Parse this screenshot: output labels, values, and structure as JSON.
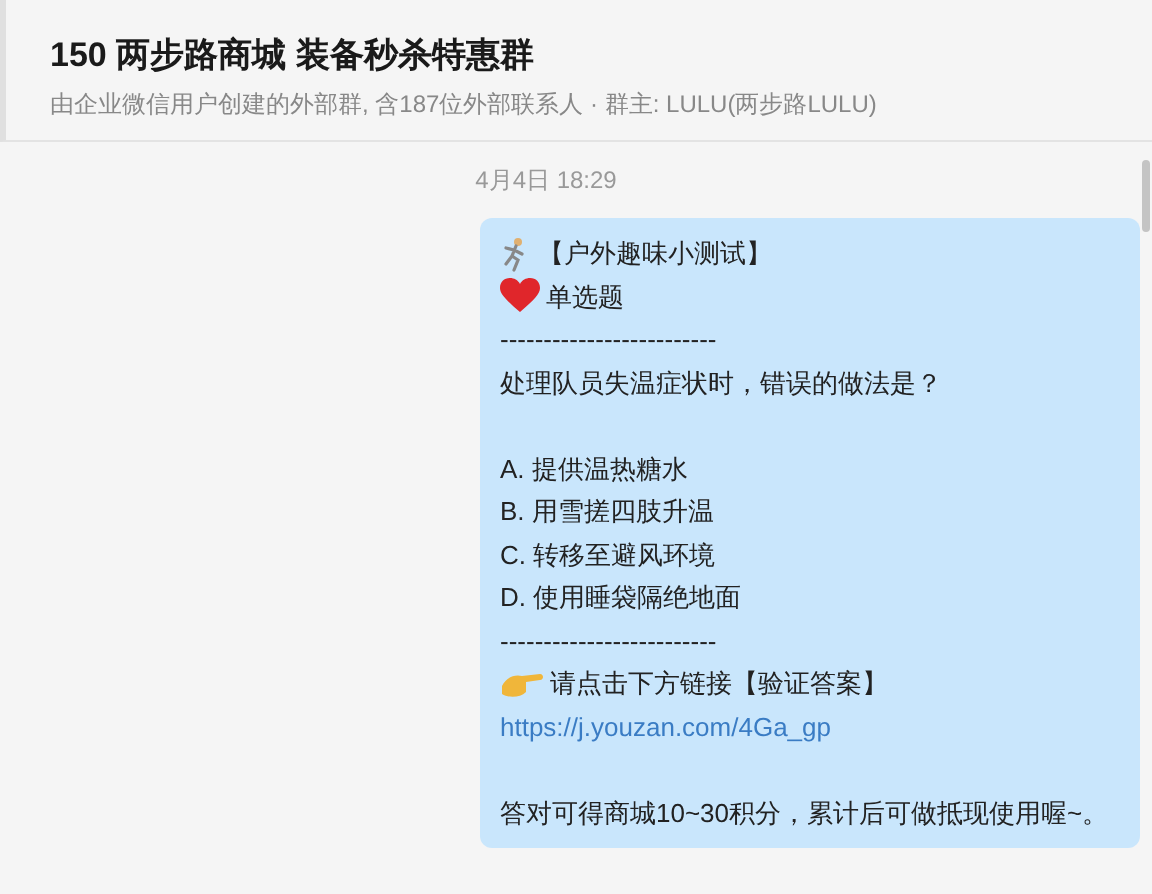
{
  "header": {
    "title": "150 两步路商城 装备秒杀特惠群",
    "subtitle": "由企业微信用户创建的外部群, 含187位外部联系人 · 群主: LULU(两步路LULU)"
  },
  "messages": [
    {
      "time": "4月4日 18:29",
      "lines": [
        {
          "kind": "runner",
          "text": "【户外趣味小测试】"
        },
        {
          "kind": "heart",
          "text": "单选题"
        },
        {
          "kind": "text",
          "text": "-------------------------"
        },
        {
          "kind": "text",
          "text": "处理队员失温症状时，错误的做法是？"
        },
        {
          "kind": "gap"
        },
        {
          "kind": "text",
          "text": "A. 提供温热糖水"
        },
        {
          "kind": "text",
          "text": "B. 用雪搓四肢升温"
        },
        {
          "kind": "text",
          "text": "C. 转移至避风环境"
        },
        {
          "kind": "text",
          "text": "D. 使用睡袋隔绝地面"
        },
        {
          "kind": "text",
          "text": "-------------------------"
        },
        {
          "kind": "hand",
          "text": "请点击下方链接【验证答案】"
        },
        {
          "kind": "link",
          "text": "https://j.youzan.com/4Ga_gp"
        },
        {
          "kind": "gap"
        },
        {
          "kind": "text",
          "text": "答对可得商城10~30积分，累计后可做抵现使用喔~。"
        }
      ]
    }
  ]
}
